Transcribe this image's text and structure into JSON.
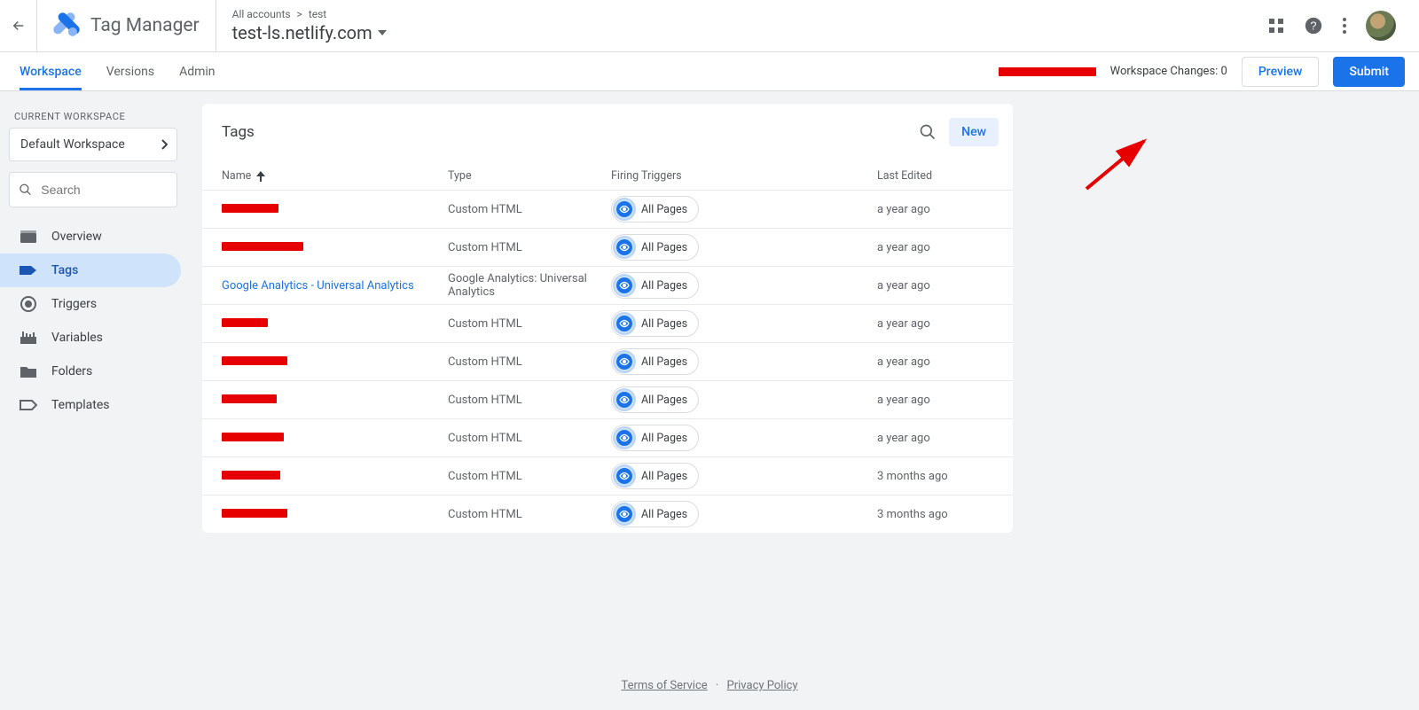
{
  "app_title": "Tag Manager",
  "breadcrumb": {
    "prefix": "All accounts",
    "sep": ">",
    "account": "test"
  },
  "container_name": "test-ls.netlify.com",
  "tabs": {
    "workspace": "Workspace",
    "versions": "Versions",
    "admin": "Admin"
  },
  "workspace_changes_label": "Workspace Changes:",
  "workspace_changes_count": "0",
  "preview_label": "Preview",
  "submit_label": "Submit",
  "current_workspace_label": "CURRENT WORKSPACE",
  "current_workspace_value": "Default Workspace",
  "search_placeholder": "Search",
  "nav": {
    "overview": "Overview",
    "tags": "Tags",
    "triggers": "Triggers",
    "variables": "Variables",
    "folders": "Folders",
    "templates": "Templates"
  },
  "card": {
    "title": "Tags",
    "new_label": "New",
    "columns": {
      "name": "Name",
      "type": "Type",
      "firing": "Firing Triggers",
      "last": "Last Edited"
    }
  },
  "trigger_chip_label": "All Pages",
  "rows": [
    {
      "name_redacted": true,
      "redact_w": 64,
      "name": "",
      "type": "Custom HTML",
      "last": "a year ago"
    },
    {
      "name_redacted": true,
      "redact_w": 92,
      "name": "",
      "type": "Custom HTML",
      "last": "a year ago"
    },
    {
      "name_redacted": false,
      "redact_w": 0,
      "name": "Google Analytics - Universal Analytics",
      "type": "Google Analytics: Universal Analytics",
      "last": "a year ago"
    },
    {
      "name_redacted": true,
      "redact_w": 52,
      "name": "",
      "type": "Custom HTML",
      "last": "a year ago"
    },
    {
      "name_redacted": true,
      "redact_w": 74,
      "name": "",
      "type": "Custom HTML",
      "last": "a year ago"
    },
    {
      "name_redacted": true,
      "redact_w": 62,
      "name": "",
      "type": "Custom HTML",
      "last": "a year ago"
    },
    {
      "name_redacted": true,
      "redact_w": 70,
      "name": "",
      "type": "Custom HTML",
      "last": "a year ago"
    },
    {
      "name_redacted": true,
      "redact_w": 66,
      "name": "",
      "type": "Custom HTML",
      "last": "3 months ago"
    },
    {
      "name_redacted": true,
      "redact_w": 74,
      "name": "",
      "type": "Custom HTML",
      "last": "3 months ago"
    }
  ],
  "footer": {
    "tos": "Terms of Service",
    "privacy": "Privacy Policy"
  }
}
